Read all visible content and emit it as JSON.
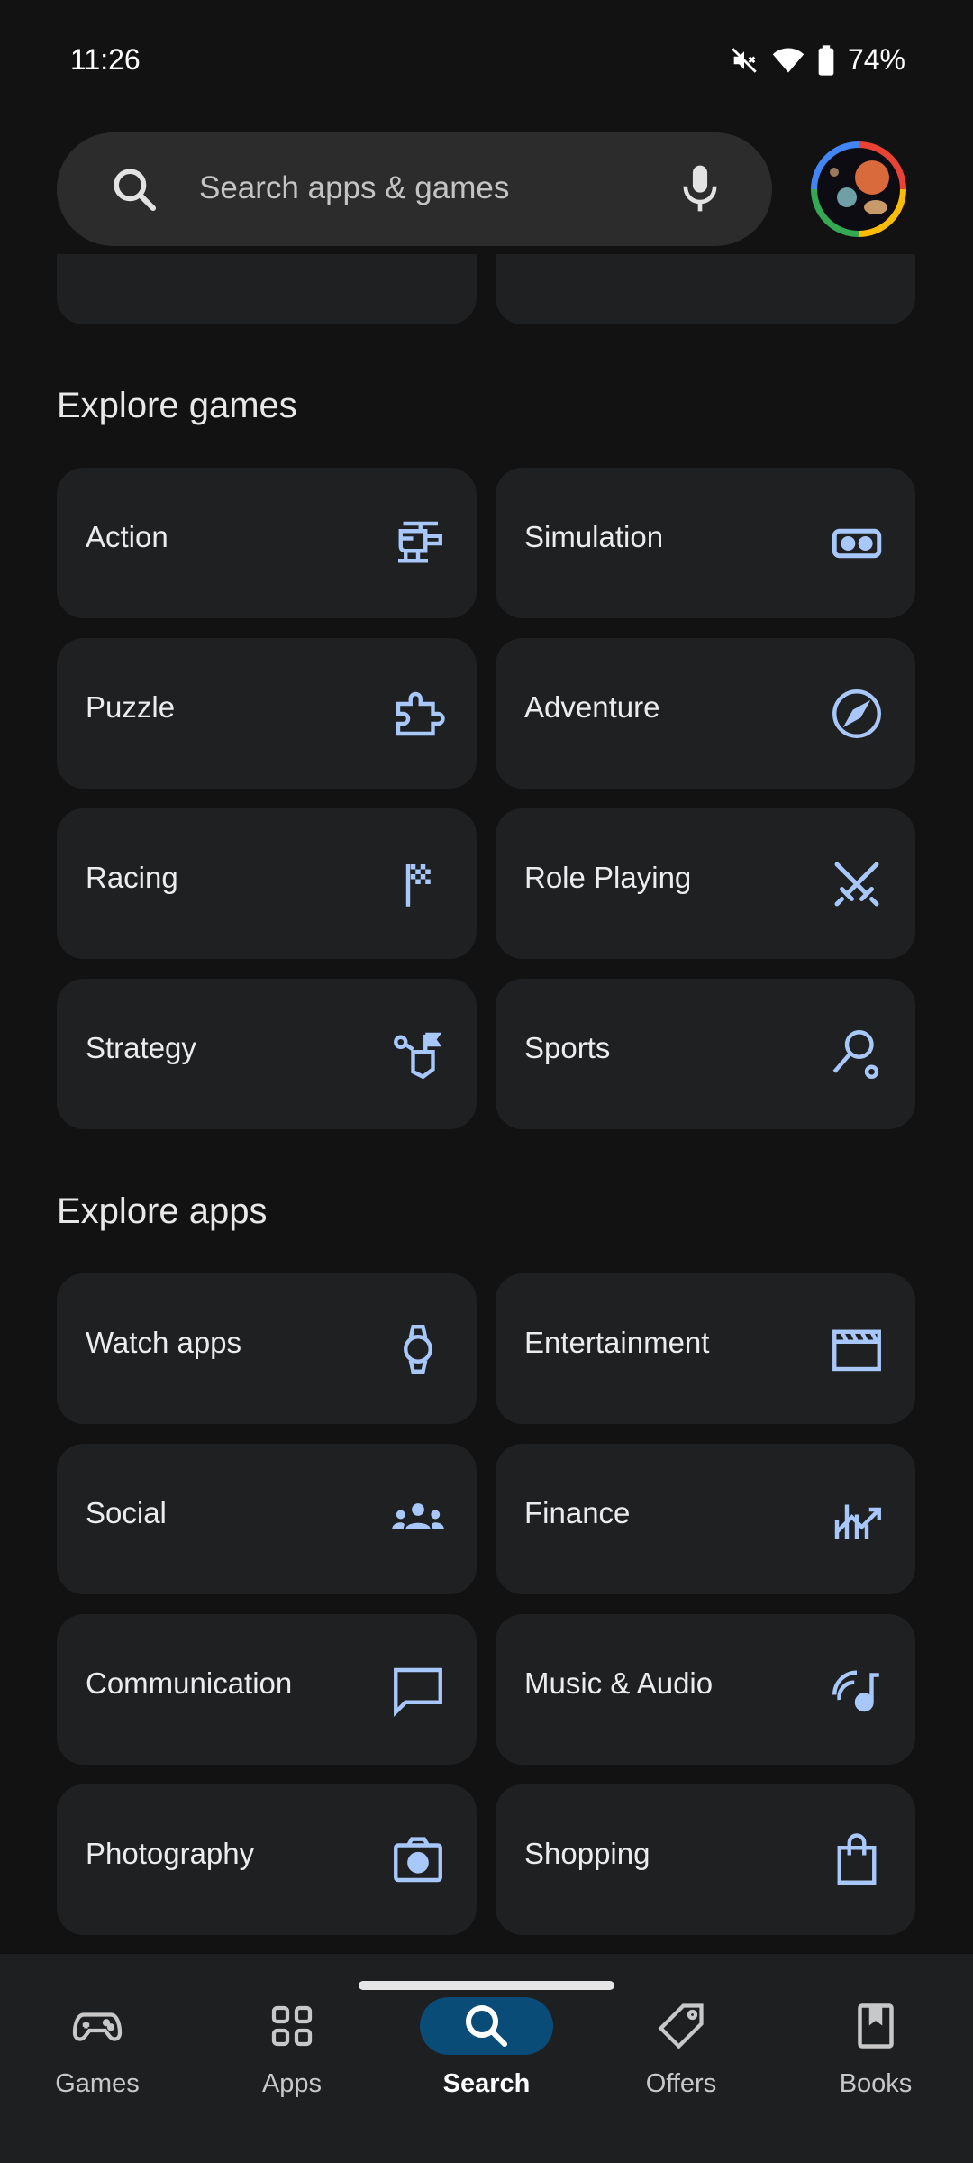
{
  "status_bar": {
    "time": "11:26",
    "battery": "74%",
    "icons": [
      "mute-icon",
      "wifi-icon",
      "battery-icon"
    ]
  },
  "search": {
    "placeholder": "Search apps & games",
    "icons": [
      "search-icon",
      "mic-icon"
    ]
  },
  "colors": {
    "background": "#121212",
    "card": "#1f2022",
    "icon_accent": "#a8c7fa",
    "nav_active_pill": "#0a4c78"
  },
  "explore_games": {
    "title": "Explore games",
    "items": [
      {
        "label": "Action",
        "icon": "helicopter-icon"
      },
      {
        "label": "Simulation",
        "icon": "vr-headset-icon"
      },
      {
        "label": "Puzzle",
        "icon": "puzzle-piece-icon"
      },
      {
        "label": "Adventure",
        "icon": "compass-icon"
      },
      {
        "label": "Racing",
        "icon": "checkered-flag-icon"
      },
      {
        "label": "Role Playing",
        "icon": "crossed-swords-icon"
      },
      {
        "label": "Strategy",
        "icon": "strategy-flag-icon"
      },
      {
        "label": "Sports",
        "icon": "racket-icon"
      }
    ]
  },
  "explore_apps": {
    "title": "Explore apps",
    "items": [
      {
        "label": "Watch apps",
        "icon": "watch-icon"
      },
      {
        "label": "Entertainment",
        "icon": "clapperboard-icon"
      },
      {
        "label": "Social",
        "icon": "group-icon"
      },
      {
        "label": "Finance",
        "icon": "chart-icon"
      },
      {
        "label": "Communication",
        "icon": "chat-bubble-icon"
      },
      {
        "label": "Music & Audio",
        "icon": "music-note-icon"
      },
      {
        "label": "Photography",
        "icon": "camera-icon"
      },
      {
        "label": "Shopping",
        "icon": "shopping-bag-icon"
      }
    ]
  },
  "bottom_nav": {
    "items": [
      {
        "label": "Games",
        "icon": "gamepad-icon",
        "active": false
      },
      {
        "label": "Apps",
        "icon": "apps-grid-icon",
        "active": false
      },
      {
        "label": "Search",
        "icon": "search-icon",
        "active": true
      },
      {
        "label": "Offers",
        "icon": "tag-icon",
        "active": false
      },
      {
        "label": "Books",
        "icon": "book-icon",
        "active": false
      }
    ]
  }
}
